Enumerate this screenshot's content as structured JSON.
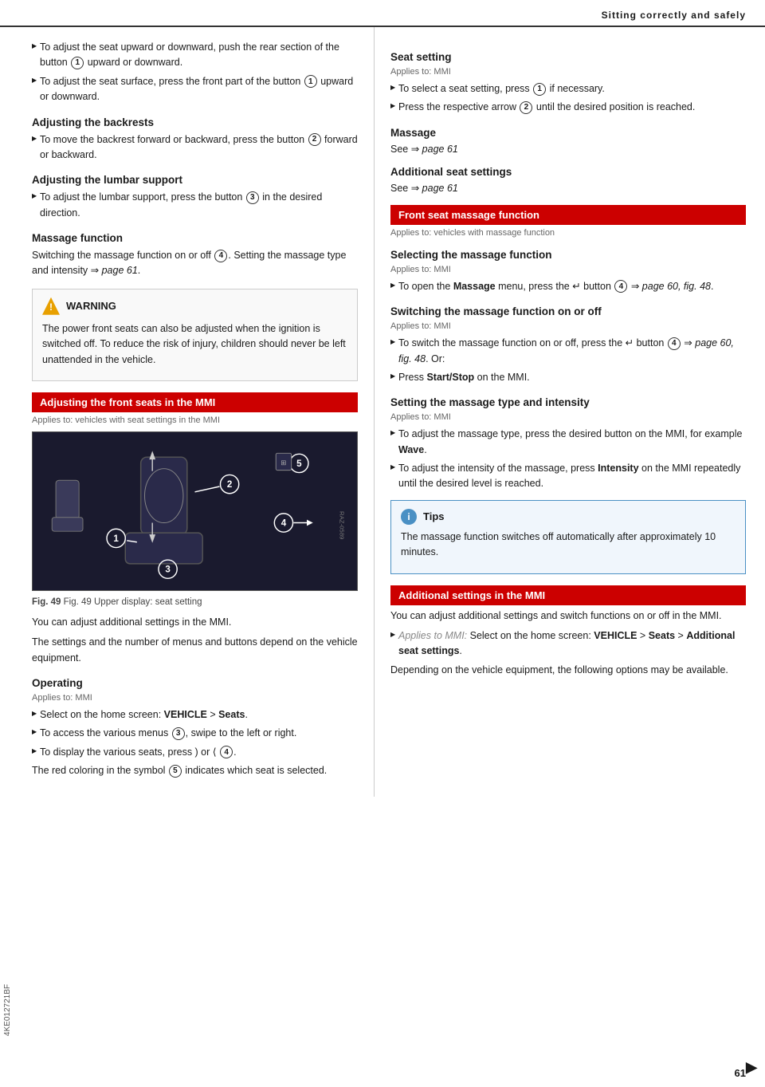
{
  "page": {
    "header": "Sitting correctly and safely",
    "page_number": "61",
    "sidebar_label": "4KE012721BF"
  },
  "left": {
    "intro_bullets": [
      "To adjust the seat upward or downward, push the rear section of the button (1) upward or downward.",
      "To adjust the seat surface, press the front part of the button (1) upward or downward."
    ],
    "adjusting_backrests": {
      "heading": "Adjusting the backrests",
      "bullets": [
        "To move the backrest forward or backward, press the button (2) forward or backward."
      ]
    },
    "adjusting_lumbar": {
      "heading": "Adjusting the lumbar support",
      "bullets": [
        "To adjust the lumbar support, press the button (3) in the desired direction."
      ]
    },
    "massage_function": {
      "heading": "Massage function",
      "text": "Switching the massage function on or off (4). Setting the massage type and intensity ⇒ page 61."
    },
    "warning": {
      "label": "WARNING",
      "text": "The power front seats can also be adjusted when the ignition is switched off. To reduce the risk of injury, children should never be left unattended in the vehicle."
    },
    "red_section": {
      "label": "Adjusting the front seats in the MMI",
      "applies_to": "Applies to: vehicles with seat settings in the MMI"
    },
    "fig_caption": "Fig. 49  Upper display: seat setting",
    "mmi_text1": "You can adjust additional settings in the MMI.",
    "mmi_text2": "The settings and the number of menus and buttons depend on the vehicle equipment.",
    "operating": {
      "heading": "Operating",
      "applies_to": "Applies to: MMI",
      "bullets": [
        "Select on the home screen: VEHICLE > Seats.",
        "To access the various menus (3), swipe to the left or right.",
        "To display the various seats, press ) or ⟨ (4)."
      ],
      "text": "The red coloring in the symbol (5) indicates which seat is selected."
    }
  },
  "right": {
    "seat_setting": {
      "heading": "Seat setting",
      "applies_to": "Applies to: MMI",
      "bullets": [
        "To select a seat setting, press (1) if necessary.",
        "Press the respective arrow (2) until the desired position is reached."
      ]
    },
    "massage": {
      "heading": "Massage",
      "see_link": "See ⇒ page 61"
    },
    "additional_seat_settings": {
      "heading": "Additional seat settings",
      "see_link": "See ⇒ page 61"
    },
    "front_massage": {
      "red_label": "Front seat massage function",
      "applies_to": "Applies to: vehicles with massage function"
    },
    "selecting_massage": {
      "heading": "Selecting the massage function",
      "applies_to": "Applies to: MMI",
      "bullet": "To open the Massage menu, press the ↵ button (4) ⇒ page 60, fig. 48."
    },
    "switching_massage": {
      "heading": "Switching the massage function on or off",
      "applies_to": "Applies to: MMI",
      "bullets": [
        "To switch the massage function on or off, press the ↵ button (4) ⇒ page 60, fig. 48. Or:",
        "Press Start/Stop on the MMI."
      ]
    },
    "setting_massage": {
      "heading": "Setting the massage type and intensity",
      "applies_to": "Applies to: MMI",
      "bullets": [
        "To adjust the massage type, press the desired button on the MMI, for example Wave.",
        "To adjust the intensity of the massage, press Intensity on the MMI repeatedly until the desired level is reached."
      ]
    },
    "tips": {
      "label": "Tips",
      "text": "The massage function switches off automatically after approximately 10 minutes."
    },
    "additional_mmi": {
      "red_label": "Additional settings in the MMI",
      "text1": "You can adjust additional settings and switch functions on or off in the MMI.",
      "bullet": "Applies to MMI: Select on the home screen: VEHICLE > Seats > Additional seat settings.",
      "text2": "Depending on the vehicle equipment, the following options may be available."
    }
  }
}
